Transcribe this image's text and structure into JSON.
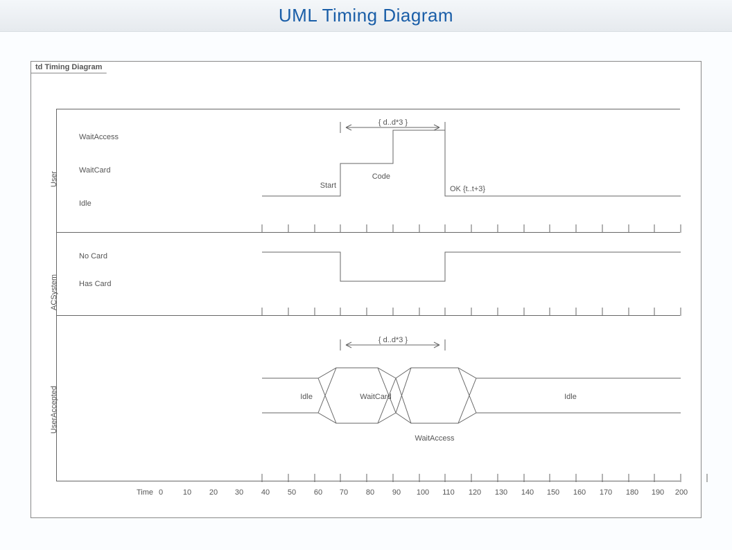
{
  "header": {
    "title": "UML Timing Diagram"
  },
  "frame": {
    "tab": "td Timing Diagram"
  },
  "lifelines": {
    "user": {
      "name": "User",
      "states": {
        "s0": "WaitAccess",
        "s1": "WaitCard",
        "s2": "Idle"
      },
      "constraint": "{ d..d*3 }",
      "events": {
        "start": "Start",
        "code": "Code",
        "ok": "OK {t..t+3}"
      }
    },
    "acs": {
      "name": "ACSystem",
      "states": {
        "s0": "No Card",
        "s1": "Has Card"
      }
    },
    "ua": {
      "name": "UserAccepted",
      "constraint": "{ d..d*3 }",
      "segs": {
        "idle1": "Idle",
        "waitcard": "WaitCard",
        "waitaccess": "WaitAccess",
        "idle2": "Idle"
      }
    }
  },
  "axis": {
    "caption": "Time",
    "ticks": [
      "0",
      "10",
      "20",
      "30",
      "40",
      "50",
      "60",
      "70",
      "80",
      "90",
      "100",
      "110",
      "120",
      "130",
      "140",
      "150",
      "160",
      "170",
      "180",
      "190",
      "200"
    ]
  },
  "chart_data": {
    "type": "timing",
    "time_range": [
      0,
      200
    ],
    "tick_interval": 10,
    "lifelines": [
      {
        "name": "User",
        "states": [
          "WaitAccess",
          "WaitCard",
          "Idle"
        ],
        "waveform": [
          {
            "t": 0,
            "state": "Idle"
          },
          {
            "t": 30,
            "state": "WaitCard"
          },
          {
            "t": 50,
            "state": "WaitAccess"
          },
          {
            "t": 70,
            "state": "Idle"
          }
        ],
        "events": [
          {
            "t": 30,
            "label": "Start"
          },
          {
            "t": 50,
            "label": "Code"
          },
          {
            "t": 70,
            "label": "OK {t..t+3}"
          }
        ],
        "constraints": [
          {
            "from": 30,
            "to": 70,
            "label": "{ d..d*3 }"
          }
        ]
      },
      {
        "name": "ACSystem",
        "states": [
          "No Card",
          "Has Card"
        ],
        "waveform": [
          {
            "t": 0,
            "state": "No Card"
          },
          {
            "t": 30,
            "state": "Has Card"
          },
          {
            "t": 70,
            "state": "No Card"
          }
        ]
      },
      {
        "name": "UserAccepted",
        "style": "compact",
        "segments": [
          {
            "from": 0,
            "to": 25,
            "label": "Idle"
          },
          {
            "from": 25,
            "to": 50,
            "label": "WaitCard"
          },
          {
            "from": 50,
            "to": 80,
            "label": "WaitAccess"
          },
          {
            "from": 80,
            "to": 200,
            "label": "Idle"
          }
        ],
        "constraints": [
          {
            "from": 30,
            "to": 70,
            "label": "{ d..d*3 }"
          }
        ]
      }
    ]
  }
}
